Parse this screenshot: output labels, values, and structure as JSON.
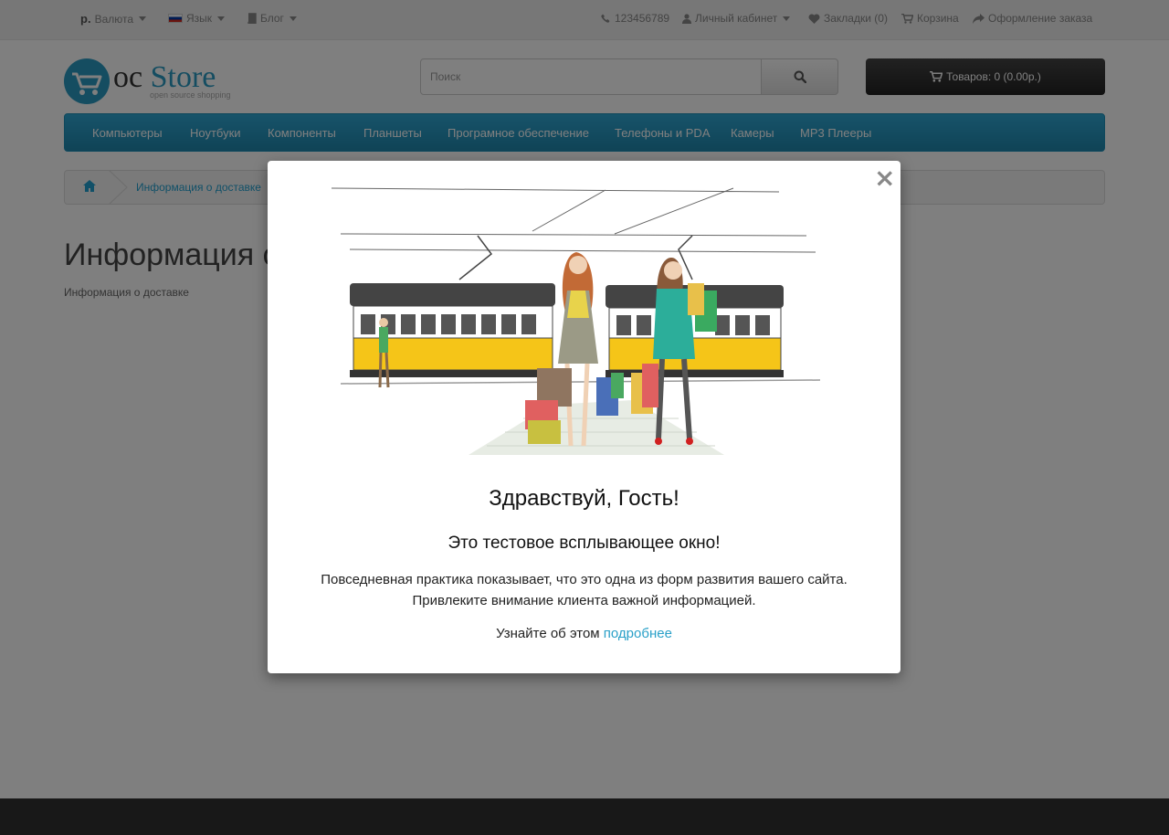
{
  "topbar": {
    "currency_symbol": "р.",
    "currency_label": "Валюта",
    "language_label": "Язык",
    "blog_label": "Блог",
    "phone": "123456789",
    "account_label": "Личный кабинет",
    "wishlist_label": "Закладки (0)",
    "cart_label": "Корзина",
    "checkout_label": "Оформление заказа"
  },
  "logo": {
    "brand_oc": "oc",
    "brand_store": "Store",
    "tagline": "open source shopping"
  },
  "search": {
    "placeholder": "Поиск"
  },
  "cart": {
    "label": "Товаров: 0 (0.00р.)"
  },
  "menu": {
    "items": [
      "Компьютеры",
      "Ноутбуки",
      "Компоненты",
      "Планшеты",
      "Програмное обеспечение",
      "Телефоны и PDA",
      "Камеры",
      "MP3 Плееры"
    ]
  },
  "breadcrumb": {
    "current": "Информация о доставке"
  },
  "content": {
    "title": "Информация о доставке",
    "text": "Информация о доставке"
  },
  "modal": {
    "close": "×",
    "heading": "Здравствуй, Гость!",
    "subheading": "Это тестовое всплывающее окно!",
    "text_line1": "Повседневная практика показывает, что это одна из форм развития вашего сайта.",
    "text_line2": "Привлеките внимание клиента важной информацией.",
    "more_prefix": "Узнайте об этом",
    "more_link": "подробнее"
  },
  "colors": {
    "accent": "#2b9bc2",
    "menu": "#229ac8",
    "link": "#23a1d1",
    "tram_yellow": "#f5c518"
  }
}
